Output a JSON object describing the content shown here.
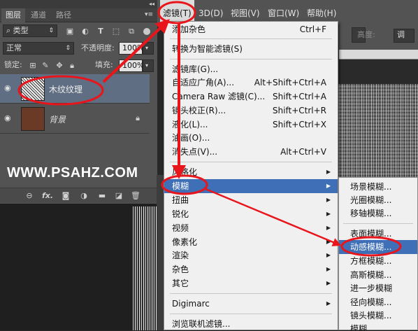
{
  "layers_panel": {
    "collapse_arrows": "◂◂",
    "tabs": [
      "图层",
      "通道",
      "路径"
    ],
    "menu_icon": "≡",
    "filter_kind": "类型",
    "filter_icons": [
      "image-filter-icon",
      "adjustment-filter-icon",
      "type-filter-icon",
      "shape-filter-icon",
      "smart-object-filter-icon"
    ],
    "blend_mode": "正常",
    "opacity_label": "不透明度:",
    "opacity_value": "100%",
    "lock_label": "锁定:",
    "fill_label": "填充:",
    "fill_value": "100%",
    "layers": [
      {
        "name": "木纹纹理",
        "selected": true,
        "visible": true
      },
      {
        "name": "背景",
        "selected": false,
        "visible": true,
        "locked": true
      }
    ],
    "footer_icons": [
      "link-icon",
      "fx-icon",
      "mask-icon",
      "adjustment-icon",
      "group-folder-icon",
      "new-layer-icon",
      "trash-icon"
    ]
  },
  "watermark": "WWW.PSAHZ.COM",
  "menubar": {
    "items": [
      "滤镜(T)",
      "3D(D)",
      "视图(V)",
      "窗口(W)",
      "帮助(H)"
    ],
    "active": "滤镜(T)"
  },
  "options_bar": {
    "height_label": "高度:",
    "adjust_button": "调"
  },
  "filter_menu": {
    "items": [
      {
        "label": "添加杂色",
        "shortcut": "Ctrl+F"
      },
      {
        "label": "转换为智能滤镜(S)"
      },
      {
        "label": "滤镜库(G)..."
      },
      {
        "label": "自适应广角(A)...",
        "shortcut": "Alt+Shift+Ctrl+A"
      },
      {
        "label": "Camera Raw 滤镜(C)...",
        "shortcut": "Shift+Ctrl+A"
      },
      {
        "label": "镜头校正(R)...",
        "shortcut": "Shift+Ctrl+R"
      },
      {
        "label": "液化(L)...",
        "shortcut": "Shift+Ctrl+X"
      },
      {
        "label": "油画(O)..."
      },
      {
        "label": "消失点(V)...",
        "shortcut": "Alt+Ctrl+V"
      },
      {
        "label": "风格化"
      },
      {
        "label": "模糊"
      },
      {
        "label": "扭曲"
      },
      {
        "label": "锐化"
      },
      {
        "label": "视频"
      },
      {
        "label": "像素化"
      },
      {
        "label": "渲染"
      },
      {
        "label": "杂色"
      },
      {
        "label": "其它"
      },
      {
        "label": "Digimarc"
      },
      {
        "label": "浏览联机滤镜..."
      }
    ],
    "submenu_arrow": "▶"
  },
  "blur_submenu": {
    "items": [
      "场景模糊...",
      "光圈模糊...",
      "移轴模糊...",
      "表面模糊...",
      "动感模糊...",
      "方框模糊...",
      "高斯模糊...",
      "进一步模糊",
      "径向模糊...",
      "镜头模糊...",
      "模糊"
    ]
  },
  "colors": {
    "menu_highlight": "#3f6fb6",
    "annotation_red": "#e8151b",
    "layer_selected": "#5f6e82"
  }
}
